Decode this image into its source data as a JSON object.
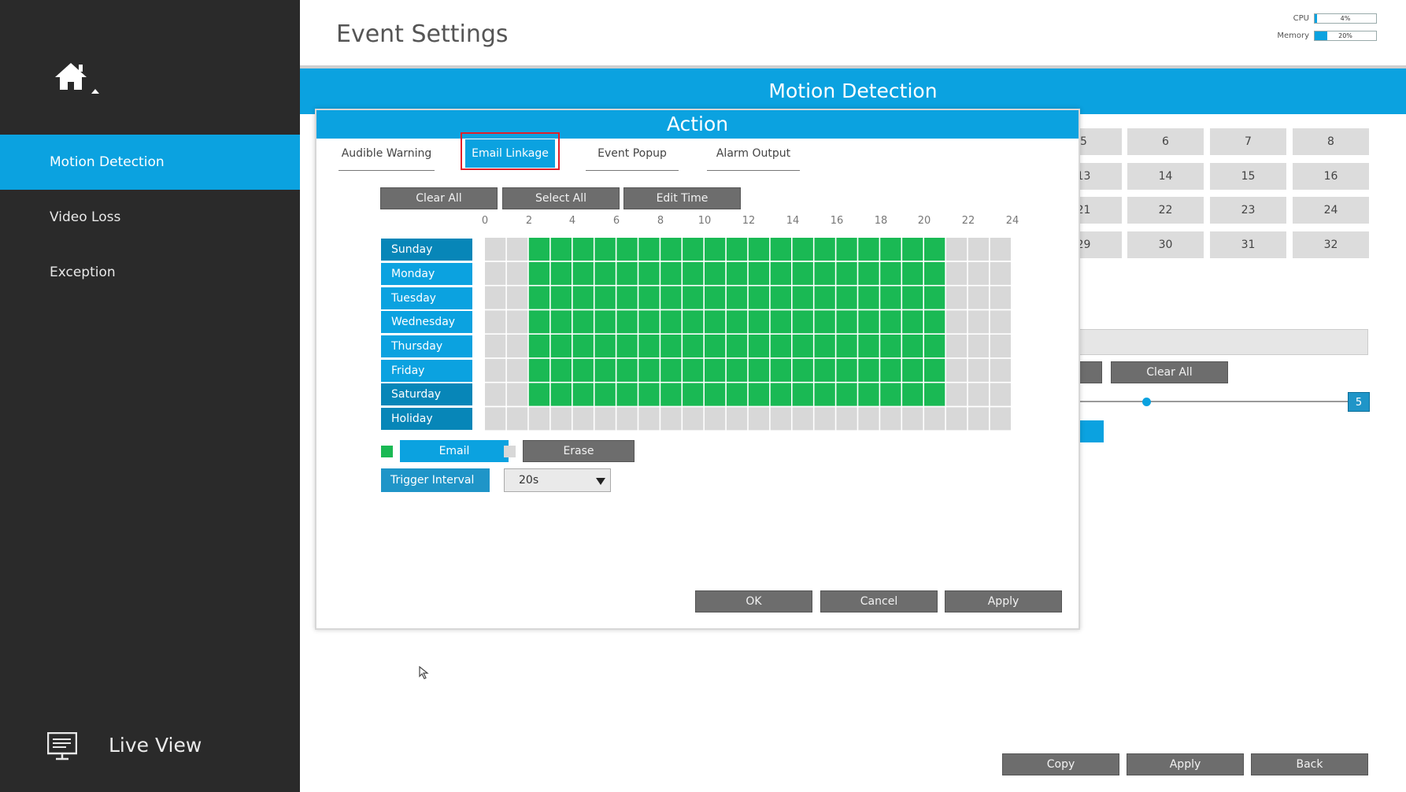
{
  "sidebar": {
    "items": [
      {
        "label": "Motion Detection",
        "active": true
      },
      {
        "label": "Video Loss",
        "active": false
      },
      {
        "label": "Exception",
        "active": false
      }
    ],
    "live_view": "Live View",
    "home_icon": "home-icon",
    "live_view_icon": "monitor-icon"
  },
  "header": {
    "title": "Event Settings",
    "cpu_label": "CPU",
    "cpu_value": "4%",
    "cpu_percent": 4,
    "memory_label": "Memory",
    "memory_value": "20%",
    "memory_percent": 20
  },
  "page": {
    "banner": "Motion Detection",
    "channels_visible": [
      "5",
      "6",
      "7",
      "8",
      "13",
      "14",
      "15",
      "16",
      "21",
      "22",
      "23",
      "24",
      "29",
      "30",
      "31",
      "32"
    ],
    "clear_all": "Clear All",
    "sensitivity_value": "5",
    "buttons": {
      "copy": "Copy",
      "apply": "Apply",
      "back": "Back"
    }
  },
  "dialog": {
    "title": "Action",
    "tabs": [
      "Audible Warning",
      "Email Linkage",
      "Event Popup",
      "Alarm Output"
    ],
    "active_tab": "Email Linkage",
    "toolbar": {
      "clear_all": "Clear All",
      "select_all": "Select All",
      "edit_time": "Edit Time"
    },
    "hours": [
      "0",
      "2",
      "4",
      "6",
      "8",
      "10",
      "12",
      "14",
      "16",
      "18",
      "20",
      "22",
      "24"
    ],
    "days": [
      "Sunday",
      "Monday",
      "Tuesday",
      "Wednesday",
      "Thursday",
      "Friday",
      "Saturday",
      "Holiday"
    ],
    "schedule": {
      "scheduled_from_hour": 2,
      "scheduled_to_hour": 21,
      "scheduled_days": [
        "Sunday",
        "Monday",
        "Tuesday",
        "Wednesday",
        "Thursday",
        "Friday",
        "Saturday"
      ]
    },
    "legend": {
      "email": "Email",
      "erase": "Erase"
    },
    "trigger_interval_label": "Trigger Interval",
    "trigger_interval_value": "20s",
    "buttons": {
      "ok": "OK",
      "cancel": "Cancel",
      "apply": "Apply"
    }
  },
  "colors": {
    "accent": "#0ba2e0",
    "scheduled": "#1ab954",
    "empty": "#d8d8d8",
    "sidebar": "#2a2a2a"
  }
}
